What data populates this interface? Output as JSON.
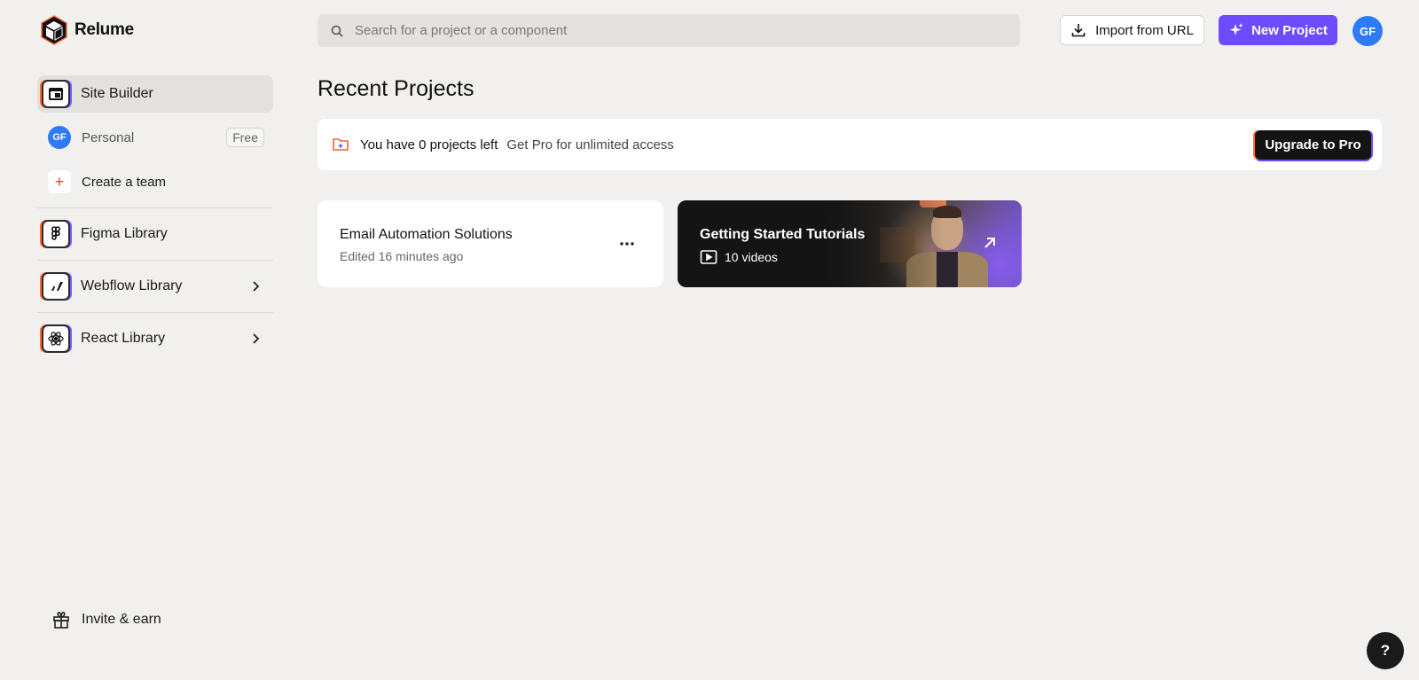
{
  "app": {
    "name": "Relume"
  },
  "sidebar": {
    "site_builder": "Site Builder",
    "personal": {
      "avatar": "GF",
      "label": "Personal",
      "badge": "Free"
    },
    "create_team": "Create a team",
    "figma": "Figma Library",
    "webflow": "Webflow Library",
    "react": "React Library",
    "invite": "Invite & earn"
  },
  "header": {
    "search_placeholder": "Search for a project or a component",
    "import_label": "Import from URL",
    "new_project_label": "New Project",
    "avatar": "GF"
  },
  "main": {
    "title": "Recent Projects",
    "banner": {
      "message": "You have 0 projects left",
      "sub": "Get Pro for unlimited access",
      "cta": "Upgrade to Pro"
    },
    "project": {
      "title": "Email Automation Solutions",
      "meta": "Edited 16 minutes ago"
    },
    "tutorial": {
      "title": "Getting Started Tutorials",
      "meta": "10 videos"
    }
  },
  "help_label": "?",
  "colors": {
    "accent": "#6b4cff",
    "avatar": "#2f7bf5",
    "background": "#f1f0ee"
  }
}
